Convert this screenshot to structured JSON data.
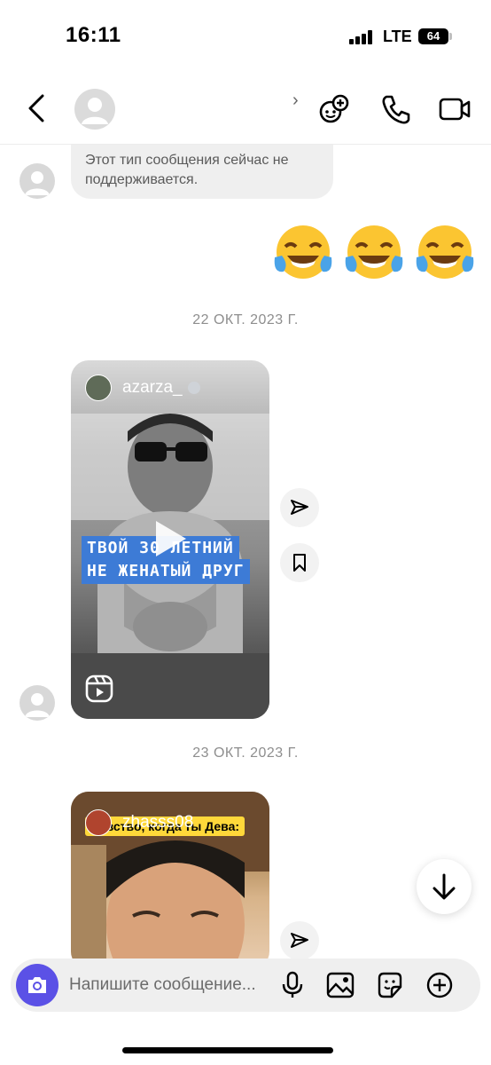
{
  "status_bar": {
    "time": "16:11",
    "network": "LTE",
    "battery": "64"
  },
  "header": {
    "back_icon": "chevron-left-icon",
    "contact_name": "",
    "icons": [
      "effects-add-icon",
      "phone-icon",
      "video-camera-icon"
    ]
  },
  "messages": {
    "incoming_unsupported": {
      "text": "Этот тип сообщения сейчас не поддерживается."
    },
    "outgoing_emojis": [
      "😂",
      "😂",
      "😂"
    ],
    "date_1": "22 ОКТ. 2023 Г.",
    "reel_1": {
      "username": "azarza_",
      "caption_line_1": "ТВОЙ 30 ЛЕТНИЙ",
      "caption_line_2": "НЕ ЖЕНАТЫЙ ДРУГ"
    },
    "date_2": "23 ОКТ. 2023 Г.",
    "reel_2": {
      "username": "zhasss08",
      "caption": "Чувство, когда ты Дева:"
    }
  },
  "composer": {
    "placeholder": "Напишите сообщение..."
  },
  "colors": {
    "accent": "#5b51e6",
    "bubble": "#efefef",
    "caption_blue": "#3d7bd6"
  }
}
